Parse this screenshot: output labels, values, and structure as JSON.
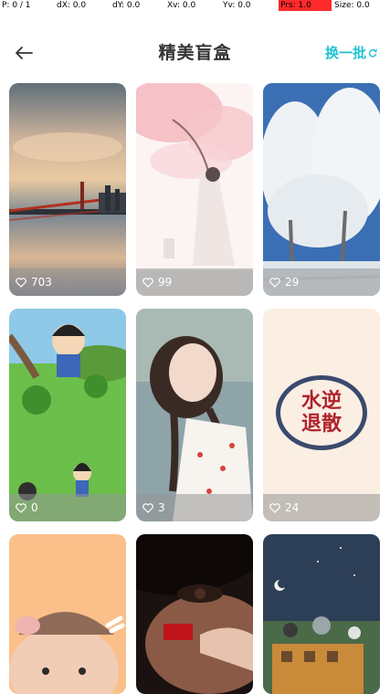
{
  "debug": {
    "p": "P: 0 / 1",
    "dx": "dX: 0.0",
    "dy": "dY: 0.0",
    "xv": "Xv: 0.0",
    "yv": "Yv: 0.0",
    "prs": "Prs: 1.0",
    "size": "Size: 0.0"
  },
  "header": {
    "back_icon": "arrow-left-icon",
    "title": "精美盲盒",
    "refresh_label": "换一批",
    "refresh_icon": "refresh-icon"
  },
  "colors": {
    "accent": "#1fc3d4",
    "title": "#333333",
    "overlay": "rgba(150,150,150,0.55)"
  },
  "cards": [
    {
      "likes": "703",
      "subject": "bridge-sunset"
    },
    {
      "likes": "99",
      "subject": "cherry-blossom-girl"
    },
    {
      "likes": "29",
      "subject": "snowy-trees"
    },
    {
      "likes": "0",
      "subject": "cartoon-boy"
    },
    {
      "likes": "3",
      "subject": "girl-portrait"
    },
    {
      "likes": "24",
      "subject": "stamp-text",
      "stamp_text": "水逆退散"
    },
    {
      "subject": "cartoon-pig"
    },
    {
      "subject": "eye-closeup"
    },
    {
      "subject": "night-scene"
    }
  ]
}
